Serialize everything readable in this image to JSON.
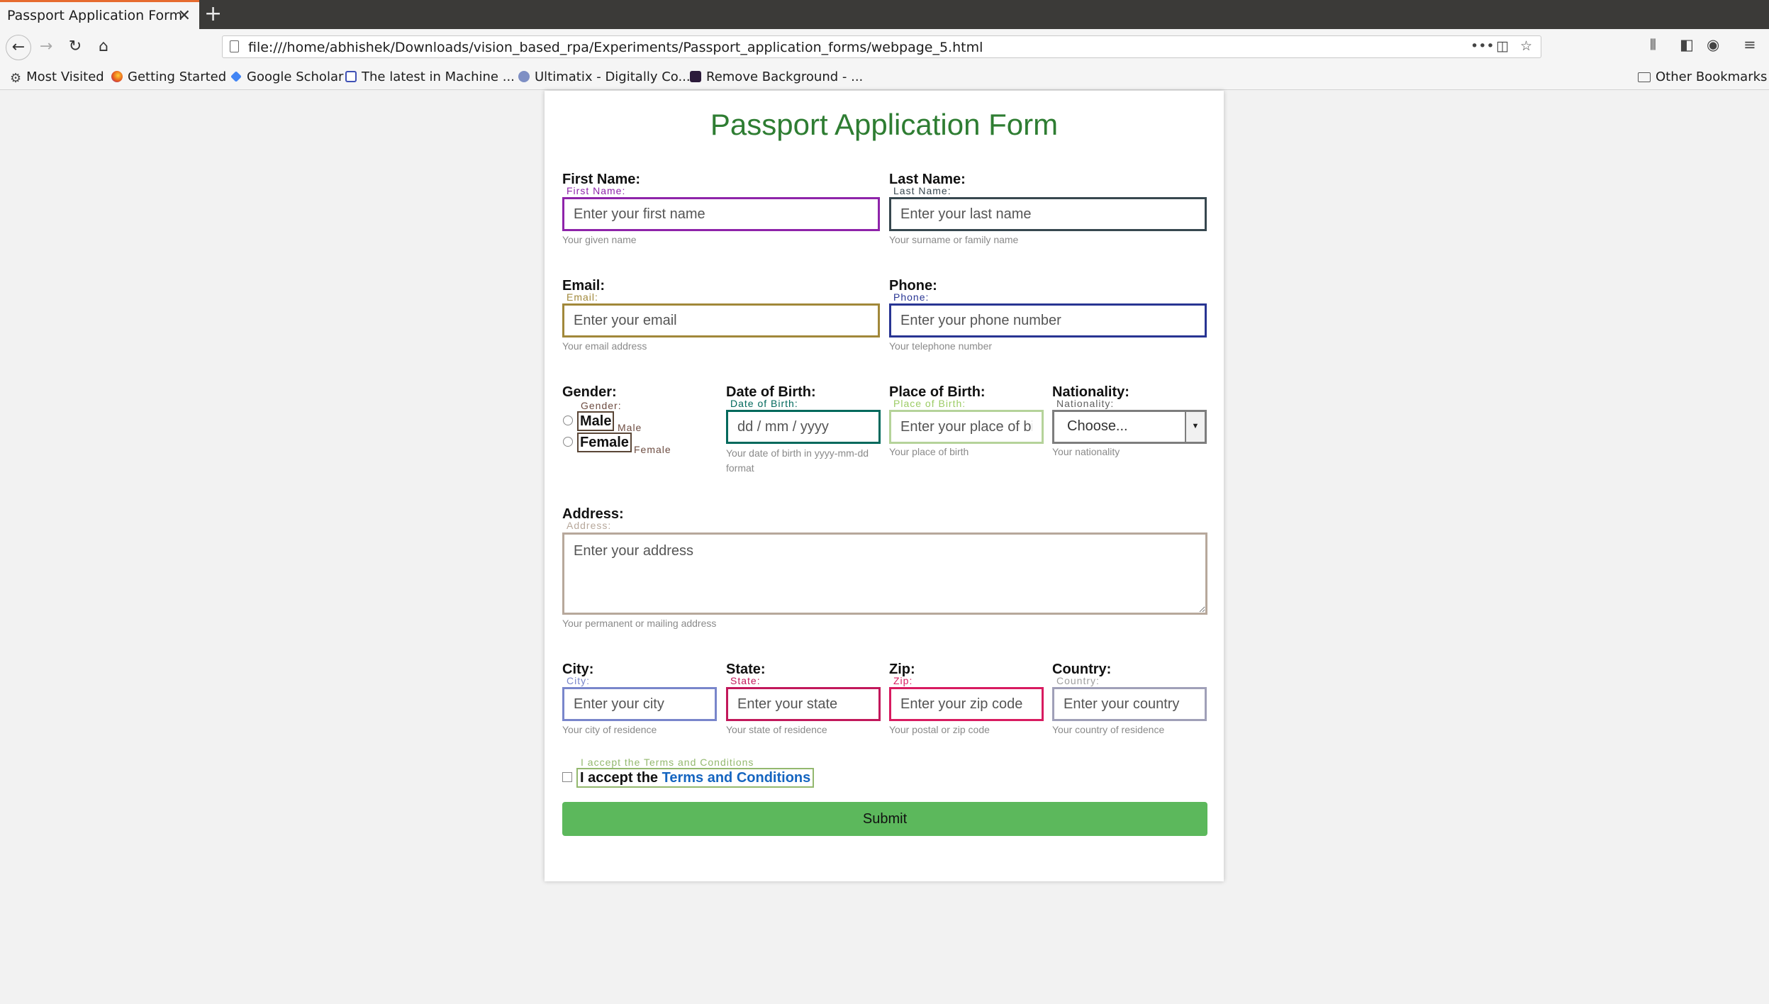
{
  "browser": {
    "tab_title": "Passport Application Form",
    "tab_close": "✕",
    "new_tab": "+",
    "url": "file:///home/abhishek/Downloads/vision_based_rpa/Experiments/Passport_application_forms/webpage_5.html",
    "bookmarks": [
      {
        "label": "Most Visited",
        "icon": "gear-icon"
      },
      {
        "label": "Getting Started",
        "icon": "firefox-icon"
      },
      {
        "label": "Google Scholar",
        "icon": "scholar-icon"
      },
      {
        "label": "The latest in Machine ...",
        "icon": "ml-icon"
      },
      {
        "label": "Ultimatix - Digitally Co...",
        "icon": "ultimatix-icon"
      },
      {
        "label": "Remove Background - ...",
        "icon": "removebg-icon"
      }
    ],
    "other_bookmarks": "Other Bookmarks"
  },
  "form": {
    "title": "Passport Application Form",
    "first_name": {
      "label": "First Name:",
      "mini": "First Name:",
      "placeholder": "Enter your first name",
      "help": "Your given name",
      "color": "#8e24aa"
    },
    "last_name": {
      "label": "Last Name:",
      "mini": "Last Name:",
      "placeholder": "Enter your last name",
      "help": "Your surname or family name",
      "color": "#37474f"
    },
    "email": {
      "label": "Email:",
      "mini": "Email:",
      "placeholder": "Enter your email",
      "help": "Your email address",
      "color": "#a1883a"
    },
    "phone": {
      "label": "Phone:",
      "mini": "Phone:",
      "placeholder": "Enter your phone number",
      "help": "Your telephone number",
      "color": "#283593"
    },
    "gender": {
      "label": "Gender:",
      "mini": "Gender:",
      "options": [
        "Male",
        "Female"
      ],
      "option_minis": [
        "Male",
        "Female"
      ]
    },
    "dob": {
      "label": "Date of Birth:",
      "mini": "Date of Birth:",
      "placeholder": "dd / mm / yyyy",
      "help": "Your date of birth in yyyy-mm-dd format",
      "color": "#00695c"
    },
    "pob": {
      "label": "Place of Birth:",
      "mini": "Place of Birth:",
      "placeholder": "Enter your place of birth",
      "help": "Your place of birth",
      "color": "#9ccc65"
    },
    "nationality": {
      "label": "Nationality:",
      "mini": "Nationality:",
      "selected": "Choose...",
      "help": "Your nationality"
    },
    "address": {
      "label": "Address:",
      "mini": "Address:",
      "placeholder": "Enter your address",
      "help": "Your permanent or mailing address"
    },
    "city": {
      "label": "City:",
      "mini": "City:",
      "placeholder": "Enter your city",
      "help": "Your city of residence",
      "color": "#7986cb"
    },
    "state": {
      "label": "State:",
      "mini": "State:",
      "placeholder": "Enter your state",
      "help": "Your state of residence",
      "color": "#c2185b"
    },
    "zip": {
      "label": "Zip:",
      "mini": "Zip:",
      "placeholder": "Enter your zip code",
      "help": "Your postal or zip code",
      "color": "#d81b60"
    },
    "country": {
      "label": "Country:",
      "mini": "Country:",
      "placeholder": "Enter your country",
      "help": "Your country of residence",
      "color": "#9e9e9e"
    },
    "terms": {
      "mini": "I accept the Terms and Conditions",
      "prefix": "I accept the",
      "link": "Terms and Conditions"
    },
    "submit": "Submit"
  }
}
